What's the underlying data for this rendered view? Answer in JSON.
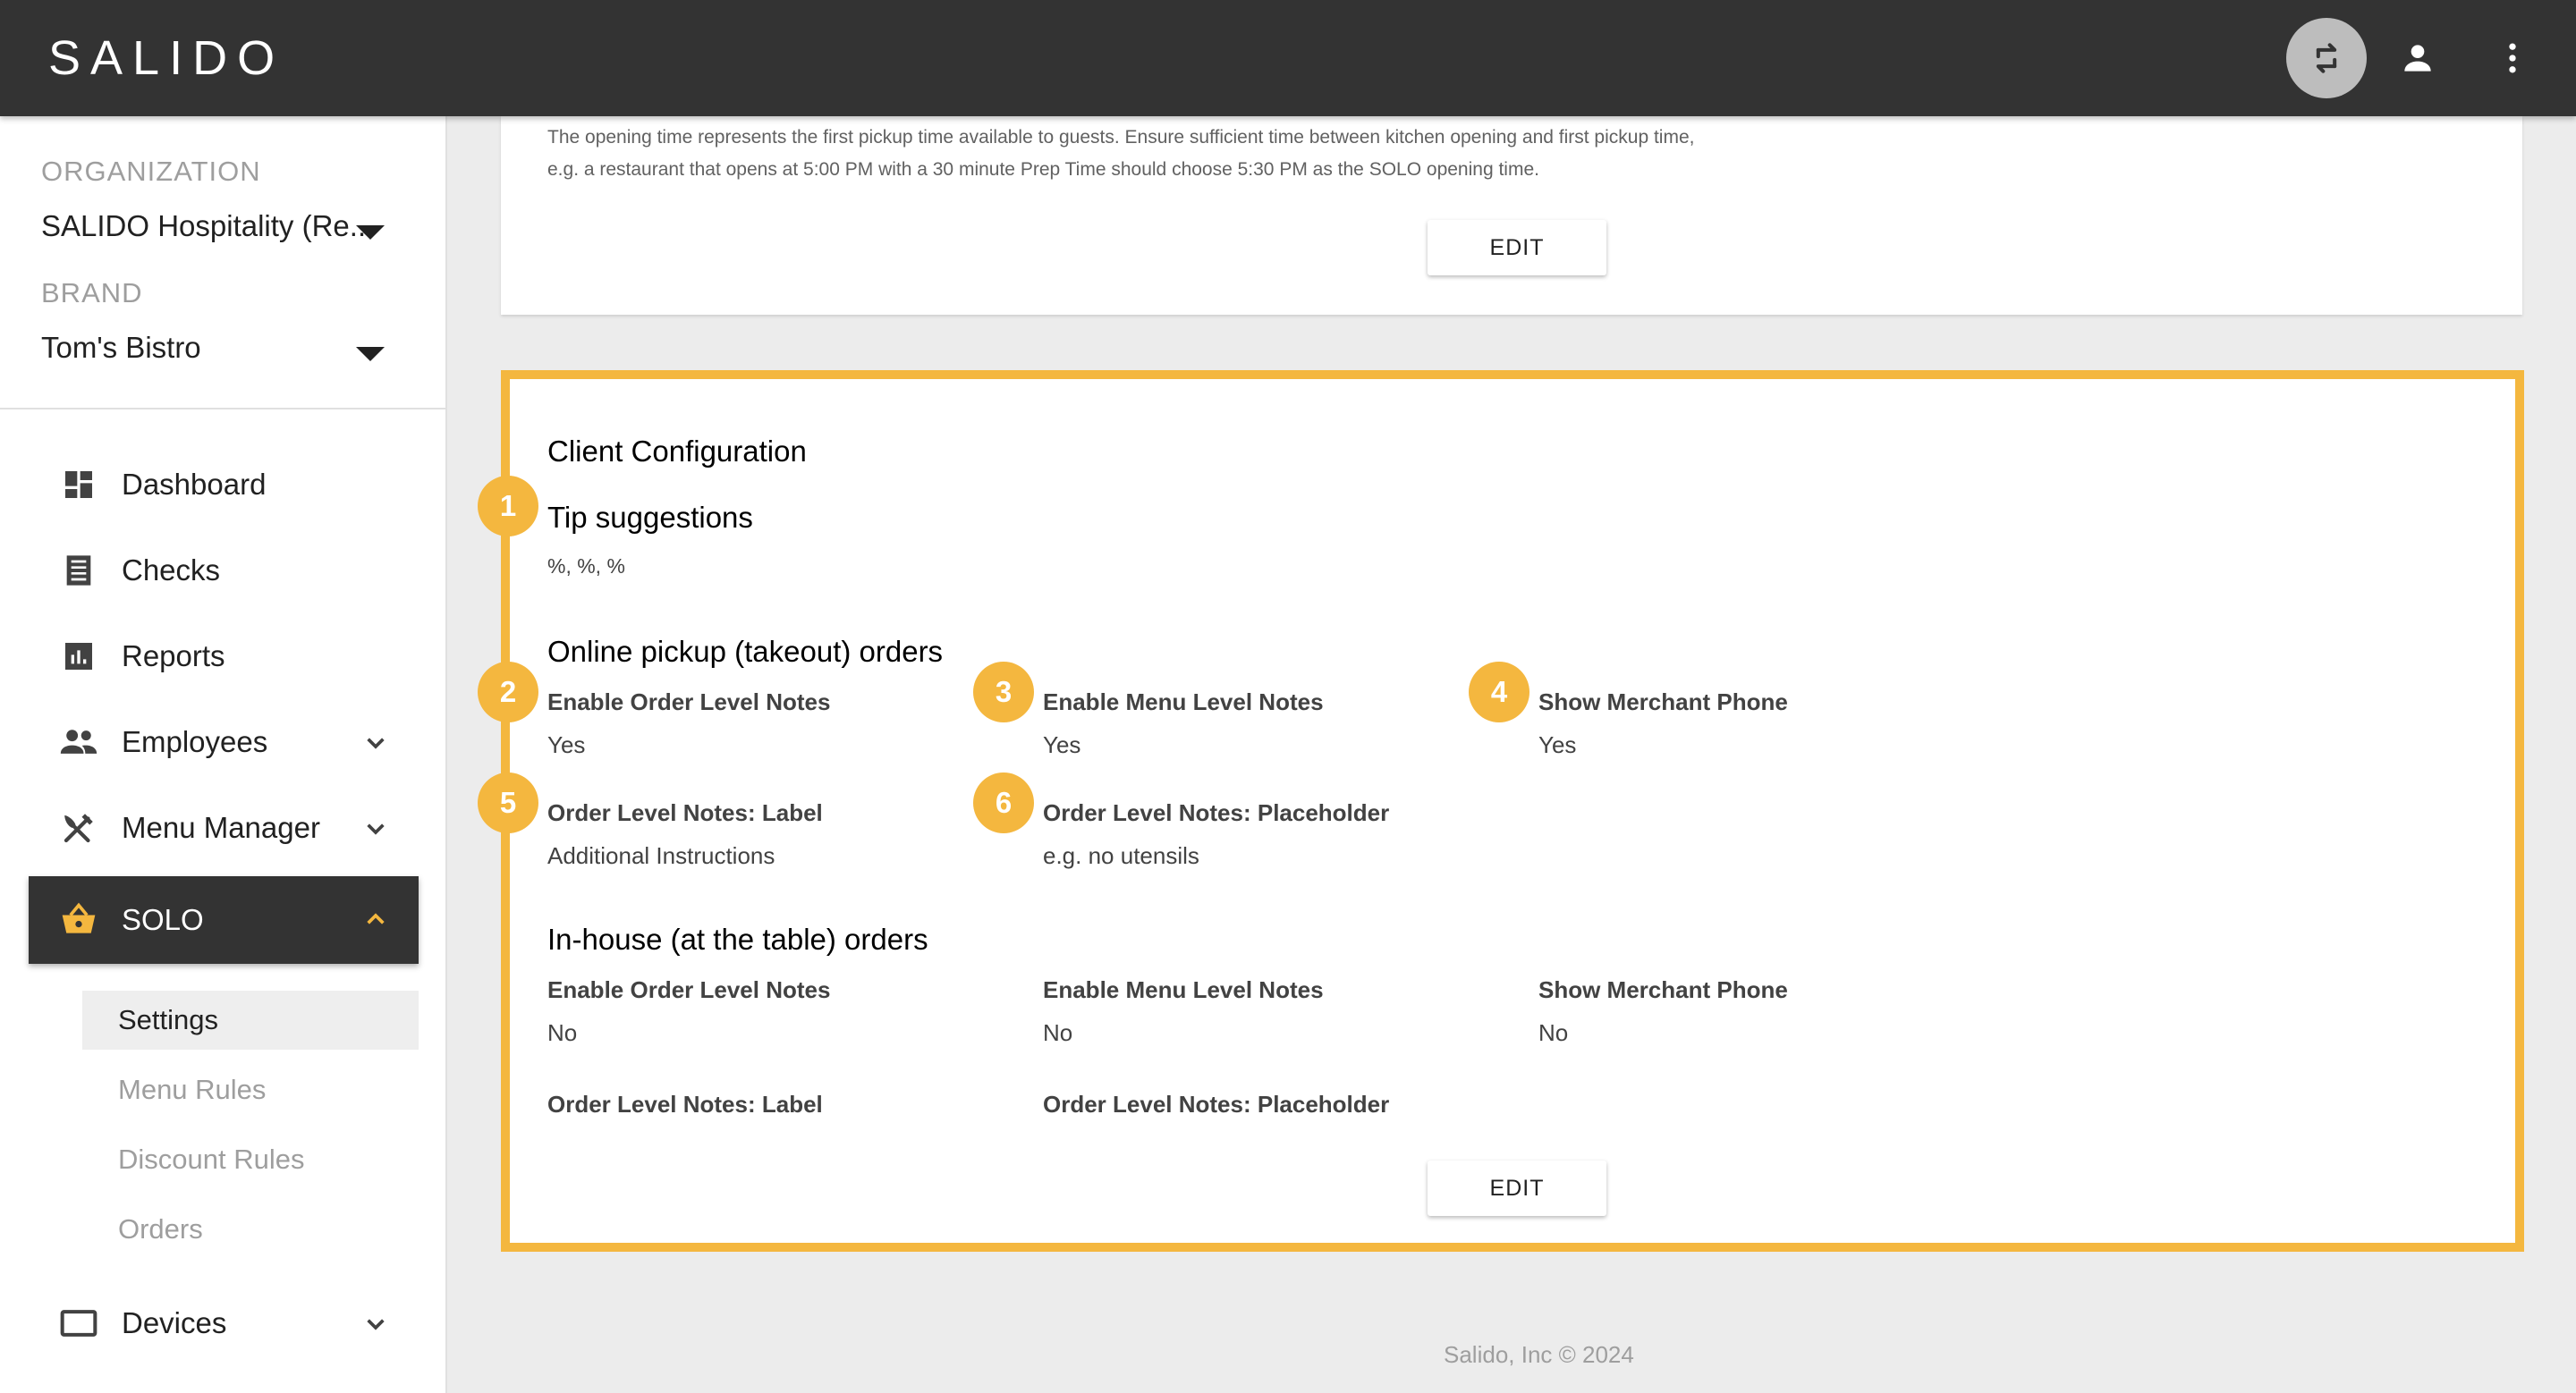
{
  "header": {
    "logo": "SALIDO"
  },
  "sidebar": {
    "org_label": "ORGANIZATION",
    "org_value": "SALIDO Hospitality (Re...",
    "brand_label": "BRAND",
    "brand_value": "Tom's Bistro",
    "nav": [
      {
        "label": "Dashboard",
        "icon": "dashboard-icon"
      },
      {
        "label": "Checks",
        "icon": "receipt-icon"
      },
      {
        "label": "Reports",
        "icon": "bar-chart-icon"
      },
      {
        "label": "Employees",
        "icon": "people-icon"
      },
      {
        "label": "Menu Manager",
        "icon": "utensils-icon"
      },
      {
        "label": "SOLO",
        "icon": "basket-icon"
      },
      {
        "label": "Devices",
        "icon": "tablet-icon"
      }
    ],
    "solo_sub": [
      "Settings",
      "Menu Rules",
      "Discount Rules",
      "Orders"
    ]
  },
  "top_card": {
    "note_line1": "The opening time represents the first pickup time available to guests. Ensure sufficient time between kitchen opening and first pickup time,",
    "note_line2": "e.g. a restaurant that opens at 5:00 PM with a 30 minute Prep Time should choose 5:30 PM as the SOLO opening time.",
    "edit_label": "EDIT"
  },
  "client_config": {
    "title": "Client Configuration",
    "tip_title": "Tip suggestions",
    "tip_value": "%, %, %",
    "pickup_title": "Online pickup (takeout) orders",
    "pickup": {
      "order_notes_label": "Enable Order Level Notes",
      "order_notes_value": "Yes",
      "menu_notes_label": "Enable Menu Level Notes",
      "menu_notes_value": "Yes",
      "phone_label": "Show Merchant Phone",
      "phone_value": "Yes",
      "notes_label_label": "Order Level Notes: Label",
      "notes_label_value": "Additional Instructions",
      "notes_placeholder_label": "Order Level Notes: Placeholder",
      "notes_placeholder_value": "e.g. no utensils"
    },
    "inhouse_title": "In-house (at the table) orders",
    "inhouse": {
      "order_notes_label": "Enable Order Level Notes",
      "order_notes_value": "No",
      "menu_notes_label": "Enable Menu Level Notes",
      "menu_notes_value": "No",
      "phone_label": "Show Merchant Phone",
      "phone_value": "No",
      "notes_label_label": "Order Level Notes: Label",
      "notes_placeholder_label": "Order Level Notes: Placeholder"
    },
    "edit_label": "EDIT",
    "badges": [
      "1",
      "2",
      "3",
      "4",
      "5",
      "6"
    ],
    "highlight_color": "#f4b73f"
  },
  "footer": "Salido, Inc © 2024"
}
